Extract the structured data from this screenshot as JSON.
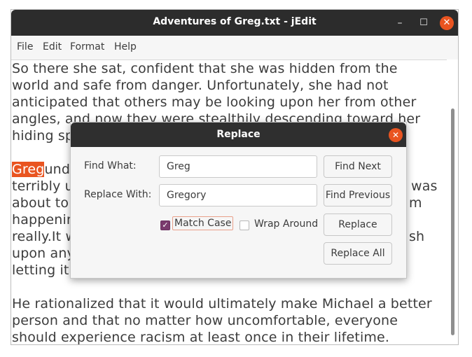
{
  "window": {
    "title": "Adventures of Greg.txt - jEdit"
  },
  "controls": {
    "minimize": "–",
    "maximize": "☐",
    "close": "✕"
  },
  "menu": [
    "File",
    "Edit",
    "Format",
    "Help"
  ],
  "editor": {
    "lines": [
      "So there she sat, confident that she was hidden from the",
      "world and safe from danger. Unfortunately, she had not",
      "anticipated that others may be looking upon her from other",
      "angles, and now they were stealthily descending toward her",
      "hiding sp",
      "",
      "und",
      "terribly u",
      "about to",
      "happenin",
      "really.It w",
      "upon any",
      "letting it",
      "",
      "He rationalized that it would ultimately make Michael a better",
      "person and that no matter how uncomfortable, everyone",
      "should experience racism at least once in their lifetime."
    ],
    "selected_word": "Greg",
    "right_fragments": [
      "was",
      "m",
      "sh"
    ]
  },
  "dialog": {
    "title": "Replace",
    "close_glyph": "✕",
    "find_label": "Find What:",
    "find_value": "Greg",
    "replace_label": "Replace With:",
    "replace_value": "Gregory",
    "match_case": "Match Case",
    "match_case_checked": true,
    "wrap_around": "Wrap Around",
    "wrap_around_checked": false,
    "buttons": {
      "find_next": "Find Next",
      "find_previous": "Find Previous",
      "replace": "Replace",
      "replace_all": "Replace All"
    }
  },
  "colors": {
    "accent": "#e95420",
    "titlebar": "#2c2c2c",
    "checkbox": "#7a3a6d"
  }
}
